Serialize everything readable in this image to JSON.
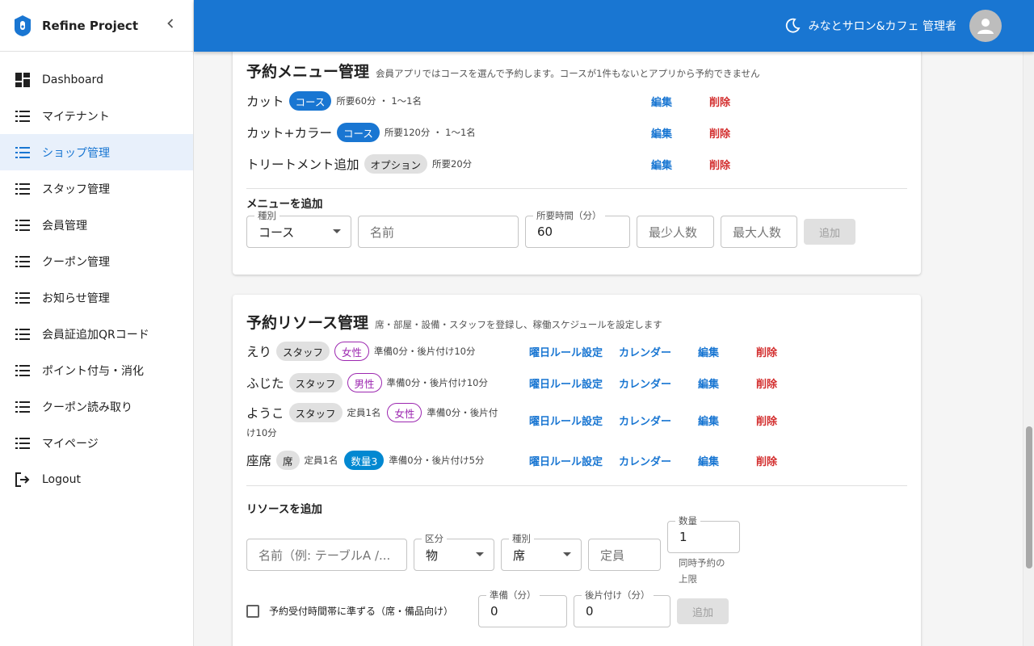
{
  "brand": {
    "title": "Refine Project"
  },
  "sidebar": {
    "items": [
      {
        "label": "Dashboard"
      },
      {
        "label": "マイテナント"
      },
      {
        "label": "ショップ管理"
      },
      {
        "label": "スタッフ管理"
      },
      {
        "label": "会員管理"
      },
      {
        "label": "クーポン管理"
      },
      {
        "label": "お知らせ管理"
      },
      {
        "label": "会員証追加QRコード"
      },
      {
        "label": "ポイント付与・消化"
      },
      {
        "label": "クーポン読み取り"
      },
      {
        "label": "マイページ"
      },
      {
        "label": "Logout"
      }
    ],
    "active_index": 2
  },
  "header": {
    "user": "みなとサロン&カフェ 管理者"
  },
  "menu_card": {
    "title": "予約メニュー管理",
    "subtitle": "会員アプリではコースを選んで予約します。コースが1件もないとアプリから予約できません",
    "rows": [
      {
        "name": "カット",
        "chip": "コース",
        "meta": "所要60分 ・ 1〜1名"
      },
      {
        "name": "カット+カラー",
        "chip": "コース",
        "meta": "所要120分 ・ 1〜1名"
      },
      {
        "name": "トリートメント追加",
        "chip": "オプション",
        "meta": "所要20分"
      }
    ],
    "edit_label": "編集",
    "delete_label": "削除",
    "add_section": "メニューを追加",
    "form": {
      "type_legend": "種別",
      "type_value": "コース",
      "name_placeholder": "名前",
      "duration_legend": "所要時間（分）",
      "duration_value": "60",
      "min_placeholder": "最少人数",
      "max_placeholder": "最大人数",
      "add_button": "追加"
    }
  },
  "resource_card": {
    "title": "予約リソース管理",
    "subtitle": "席・部屋・設備・スタッフを登録し、稼働スケジュールを設定します",
    "rows": [
      {
        "name": "えり",
        "chips": [
          "スタッフ",
          "女性"
        ],
        "meta": "準備0分・後片付け10分"
      },
      {
        "name": "ふじた",
        "chips": [
          "スタッフ",
          "男性"
        ],
        "meta": "準備0分・後片付け10分"
      },
      {
        "name": "ようこ",
        "chips": [
          "スタッフ",
          "定員1名",
          "女性"
        ],
        "meta_line1": "準備0分・後片付",
        "meta_line2": "け10分"
      },
      {
        "name": "座席",
        "chips": [
          "席",
          "定員1名",
          "数量3"
        ],
        "meta": "準備0分・後片付け5分"
      }
    ],
    "rule_label": "曜日ルール設定",
    "calendar_label": "カレンダー",
    "edit_label": "編集",
    "delete_label": "削除",
    "add_section": "リソースを追加",
    "form": {
      "name_placeholder": "名前（例: テーブルA /...",
      "category_legend": "区分",
      "category_value": "物",
      "type_legend": "種別",
      "type_value": "席",
      "capacity_placeholder": "定員",
      "quantity_legend": "数量",
      "quantity_value": "1",
      "quantity_helper_1": "同時予約の",
      "quantity_helper_2": "上限",
      "checkbox_label": "予約受付時間帯に準ずる（席・備品向け）",
      "prep_legend": "準備（分）",
      "prep_value": "0",
      "cleanup_legend": "後片付け（分）",
      "cleanup_value": "0",
      "add_button": "追加"
    }
  }
}
